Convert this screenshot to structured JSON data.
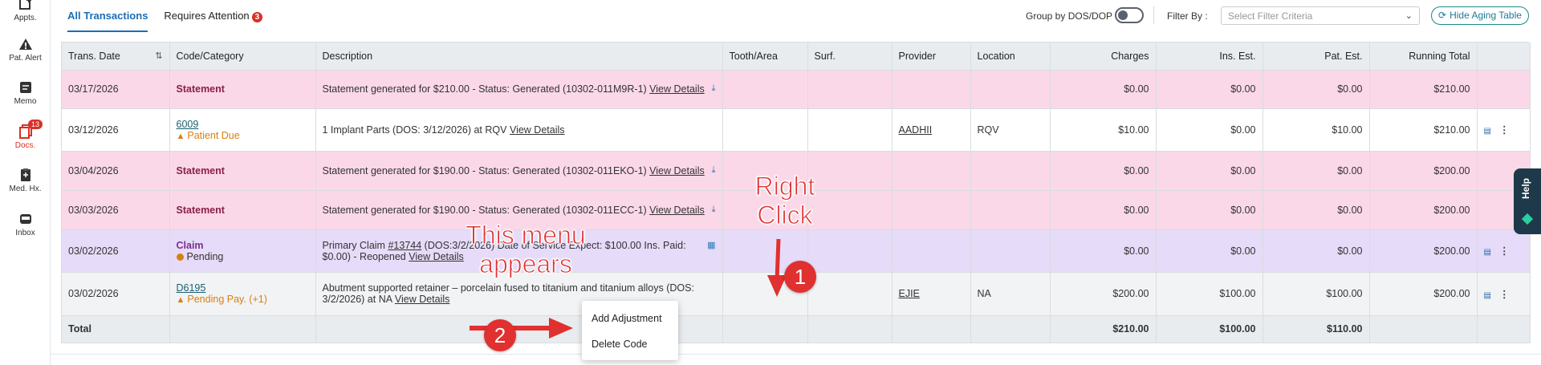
{
  "sidebar": {
    "items": [
      {
        "label": "Appts.",
        "icon": "calendar-plus-icon"
      },
      {
        "label": "Pat. Alert",
        "icon": "alert-triangle-icon"
      },
      {
        "label": "Memo",
        "icon": "memo-icon"
      },
      {
        "label": "Docs.",
        "icon": "documents-icon",
        "badge": "13"
      },
      {
        "label": "Med. Hx.",
        "icon": "clipboard-icon"
      },
      {
        "label": "Inbox",
        "icon": "inbox-icon"
      }
    ]
  },
  "tabs": [
    {
      "label": "All Transactions",
      "active": true
    },
    {
      "label": "Requires Attention",
      "badge": "3"
    }
  ],
  "toolbar": {
    "group_label": "Group by DOS/DOP",
    "filter_label": "Filter By :",
    "filter_placeholder": "Select Filter Criteria",
    "hide_aging_label": "Hide Aging Table"
  },
  "table": {
    "headers": {
      "date": "Trans. Date",
      "code": "Code/Category",
      "desc": "Description",
      "tooth": "Tooth/Area",
      "surf": "Surf.",
      "provider": "Provider",
      "location": "Location",
      "charges": "Charges",
      "ins_est": "Ins. Est.",
      "pat_est": "Pat. Est.",
      "running": "Running Total"
    },
    "rows": [
      {
        "date": "03/17/2026",
        "code": "Statement",
        "desc": "Statement generated for $210.00 - Status: Generated (10302-011M9R-1)",
        "link": "View Details",
        "tooth": "",
        "surf": "",
        "provider": "",
        "location": "",
        "charges": "$0.00",
        "ins_est": "$0.00",
        "pat_est": "$0.00",
        "running": "$210.00"
      },
      {
        "date": "03/12/2026",
        "code": "6009",
        "sub": "Patient Due",
        "desc": "1 Implant Parts (DOS: 3/12/2026) at RQV",
        "link": "View Details",
        "tooth": "",
        "surf": "",
        "provider": "AADHII",
        "location": "RQV",
        "charges": "$10.00",
        "ins_est": "$0.00",
        "pat_est": "$10.00",
        "running": "$210.00"
      },
      {
        "date": "03/04/2026",
        "code": "Statement",
        "desc": "Statement generated for $190.00 - Status: Generated (10302-011EKO-1)",
        "link": "View Details",
        "tooth": "",
        "surf": "",
        "provider": "",
        "location": "",
        "charges": "$0.00",
        "ins_est": "$0.00",
        "pat_est": "$0.00",
        "running": "$200.00"
      },
      {
        "date": "03/03/2026",
        "code": "Statement",
        "desc": "Statement generated for $190.00 - Status: Generated (10302-011ECC-1)",
        "link": "View Details",
        "tooth": "",
        "surf": "",
        "provider": "",
        "location": "",
        "charges": "$0.00",
        "ins_est": "$0.00",
        "pat_est": "$0.00",
        "running": "$200.00"
      },
      {
        "date": "03/02/2026",
        "code": "Claim",
        "sub": "Pending",
        "desc_pre": "Primary Claim",
        "claim_link": "#13744",
        "desc": "(DOS:3/2/2026) Date of Service Expect: $100.00 Ins. Paid: $0.00) - Reopened",
        "link": "View Details",
        "tooth": "",
        "surf": "",
        "provider": "",
        "location": "",
        "charges": "$0.00",
        "ins_est": "$0.00",
        "pat_est": "$0.00",
        "running": "$200.00"
      },
      {
        "date": "03/02/2026",
        "code": "D6195",
        "sub": "Pending Pay. (+1)",
        "desc": "Abutment supported retainer – porcelain fused to titanium and titanium alloys (DOS: 3/2/2026) at NA",
        "link": "View Details",
        "tooth": "",
        "surf": "",
        "provider": "EJIE",
        "location": "NA",
        "charges": "$200.00",
        "ins_est": "$100.00",
        "pat_est": "$100.00",
        "running": "$200.00"
      }
    ],
    "total": {
      "label": "Total",
      "charges": "$210.00",
      "ins_est": "$100.00",
      "pat_est": "$110.00"
    }
  },
  "context_menu": {
    "items": [
      "Add Adjustment",
      "Delete Code"
    ]
  },
  "help_label": "Help",
  "annotations": {
    "right_click": "Right Click",
    "menu_appears": "This menu appears",
    "step1": "1",
    "step2": "2"
  },
  "colors": {
    "accent": "#1a6fb5",
    "statement_row": "#fbd8e8",
    "claim_row": "#e6dbf8",
    "annotation": "#e03030"
  }
}
